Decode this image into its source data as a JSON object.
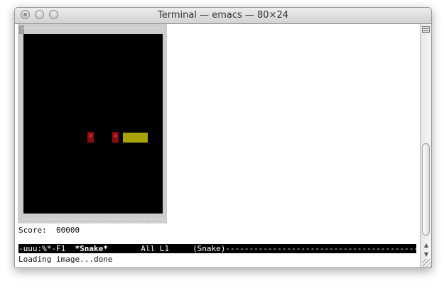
{
  "window": {
    "title": "Terminal — emacs — 80×24"
  },
  "game": {
    "score_line": "Score:  00000",
    "fruit_glyph": "*",
    "colors": {
      "playfield": "#000000",
      "snake": "#a8a405",
      "fruit": "#8a0e0e",
      "frame": "#cdcdcd"
    }
  },
  "modeline": {
    "status": "-uuu:%*-F1  ",
    "buffer": "*Snake*",
    "position": "       All L1     ",
    "mode": "(Snake)",
    "fill": "--------------------------------------------------------------"
  },
  "echo_area": {
    "message": "Loading image...done"
  }
}
